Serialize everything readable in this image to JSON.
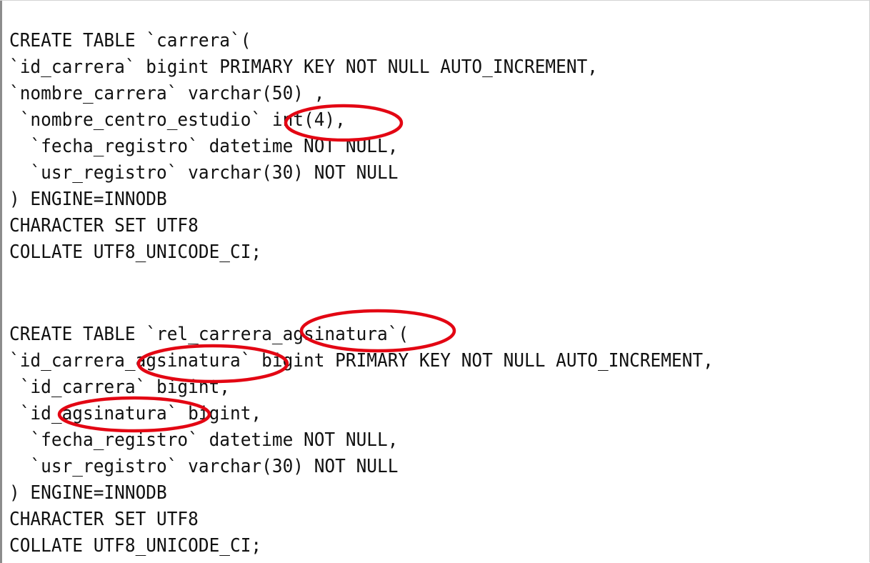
{
  "code_lines": [
    "CREATE TABLE `carrera`(",
    "`id_carrera` bigint PRIMARY KEY NOT NULL AUTO_INCREMENT,",
    "`nombre_carrera` varchar(50) ,",
    " `nombre_centro_estudio` int(4),",
    "  `fecha_registro` datetime NOT NULL,",
    "  `usr_registro` varchar(30) NOT NULL",
    ") ENGINE=INNODB",
    "CHARACTER SET UTF8",
    "COLLATE UTF8_UNICODE_CI;",
    "",
    "",
    "CREATE TABLE `rel_carrera_agsinatura`(",
    "`id_carrera_agsinatura` bigint PRIMARY KEY NOT NULL AUTO_INCREMENT,",
    " `id_carrera` bigint,",
    " `id_agsinatura` bigint,",
    "  `fecha_registro` datetime NOT NULL,",
    "  `usr_registro` varchar(30) NOT NULL",
    ") ENGINE=INNODB",
    "CHARACTER SET UTF8",
    "COLLATE UTF8_UNICODE_CI;"
  ],
  "colors": {
    "background": "#ffffff",
    "text": "#111111",
    "annotation": "#e30613",
    "left_border": "#8c8c8c"
  }
}
